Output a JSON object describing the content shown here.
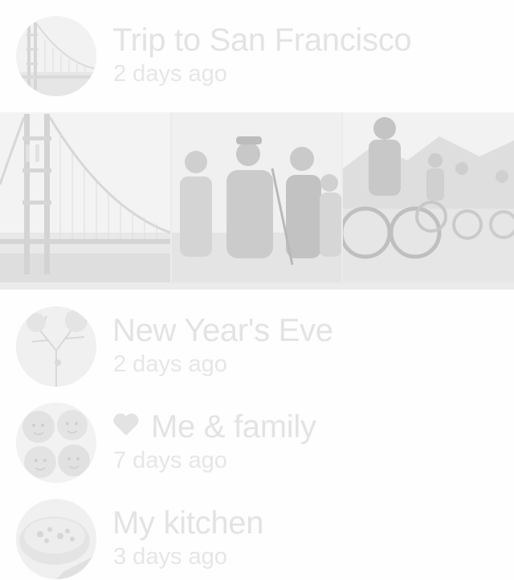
{
  "albums": [
    {
      "title": "Trip to San Francisco",
      "meta": "2 days ago",
      "thumbnail": "golden-gate-bridge",
      "expanded": true
    },
    {
      "title": "New Year's Eve",
      "meta": "2 days ago",
      "thumbnail": "tree-branches"
    },
    {
      "title": "Me & family",
      "meta": "7 days ago",
      "thumbnail": "family-faces",
      "favorite_icon": "heart-icon"
    },
    {
      "title": "My kitchen",
      "meta": "3 days ago",
      "thumbnail": "soup-bowl"
    }
  ],
  "photos": [
    {
      "subject": "golden-gate-bridge"
    },
    {
      "subject": "hiking-group"
    },
    {
      "subject": "mountain-bikers"
    }
  ],
  "colors": {
    "text": "#e3e3e3",
    "background": "#fefefe",
    "strip": "#ebebeb"
  }
}
